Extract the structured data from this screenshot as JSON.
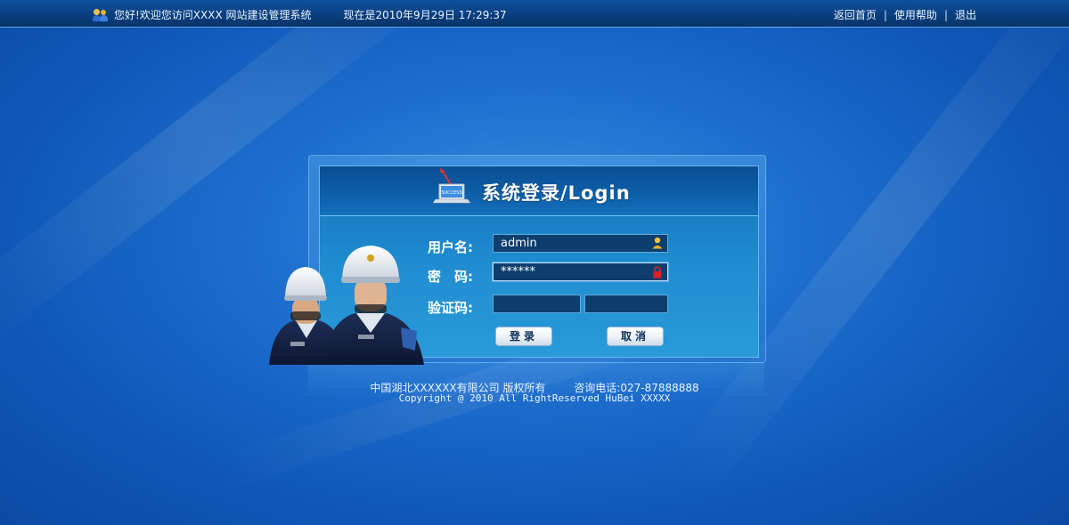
{
  "topbar": {
    "greeting": "您好!欢迎您访问XXXX 网站建设管理系统",
    "time": "现在是2010年9月29日 17:29:37",
    "links": {
      "home": "返回首页",
      "help": "使用帮助",
      "logout": "退出"
    },
    "separator": "|"
  },
  "login": {
    "title": "系统登录/Login",
    "laptop_text": "SUCCESS",
    "username_label": "用户名:",
    "username_value": "admin",
    "password_label": "密　码:",
    "password_value": "******",
    "captcha_label": "验证码:",
    "captcha_value": "",
    "submit_label": "登录",
    "cancel_label": "取消"
  },
  "footer": {
    "company": "中国湖北XXXXXX有限公司 版权所有",
    "phone": "咨询电话:027-87888888",
    "copyright": "Copyright @ 2010 All RightReserved HuBei XXXXX"
  },
  "colors": {
    "background": "#1f6fcf",
    "topbar": "#0a3f80",
    "panel": "#1f8cd0",
    "field": "#0d3f6e"
  }
}
